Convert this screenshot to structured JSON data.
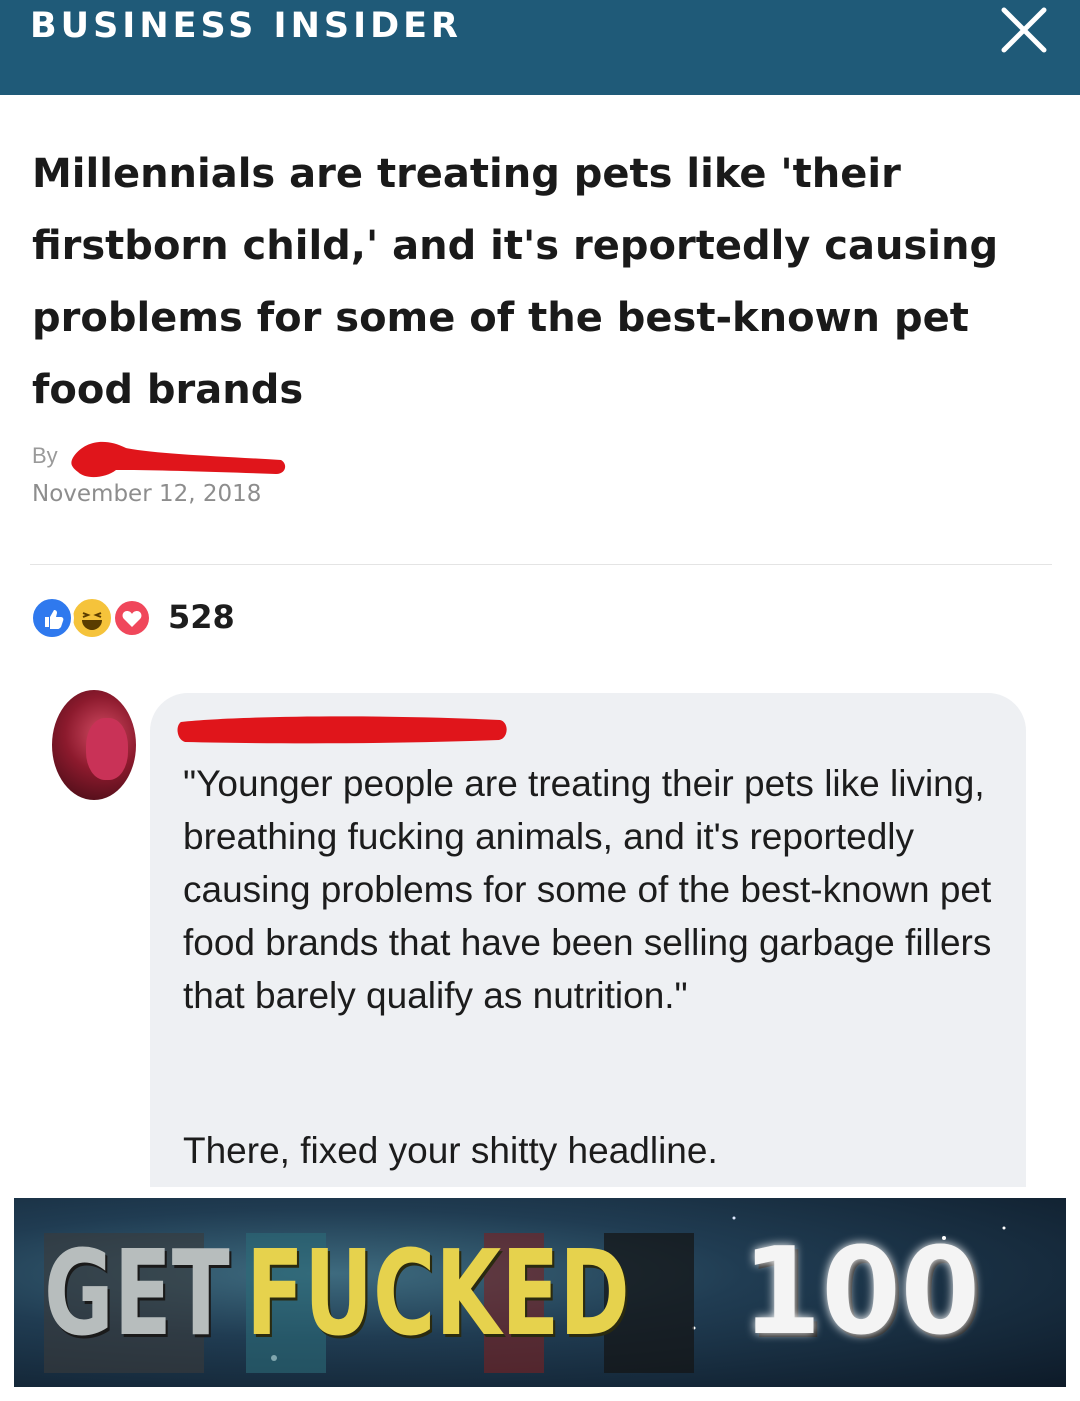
{
  "header": {
    "brand": "BUSINESS INSIDER",
    "close_icon": "close-x-icon",
    "background_color": "#1f5a78"
  },
  "article": {
    "headline": "Millennials are treating pets like 'their firstborn child,' and it's reportedly causing problems for some of the best-known pet food brands",
    "byline_prefix": "By",
    "date": "November 12, 2018"
  },
  "reactions": {
    "icons": [
      "like-icon",
      "haha-icon",
      "love-icon"
    ],
    "count": "528"
  },
  "comment": {
    "text": "\"Younger people are treating their pets like living, breathing fucking animals, and it's reportedly causing problems for some of the best-known pet food brands that have been selling garbage fillers that barely qualify as nutrition.\"",
    "followup": "There, fixed your shitty headline."
  },
  "meme": {
    "word1": "GET",
    "word2": "FUCKED",
    "number": "100"
  },
  "colors": {
    "redaction": "#e0151b",
    "like": "#2f79ee",
    "haha": "#f5c33b",
    "love": "#f0475b"
  }
}
